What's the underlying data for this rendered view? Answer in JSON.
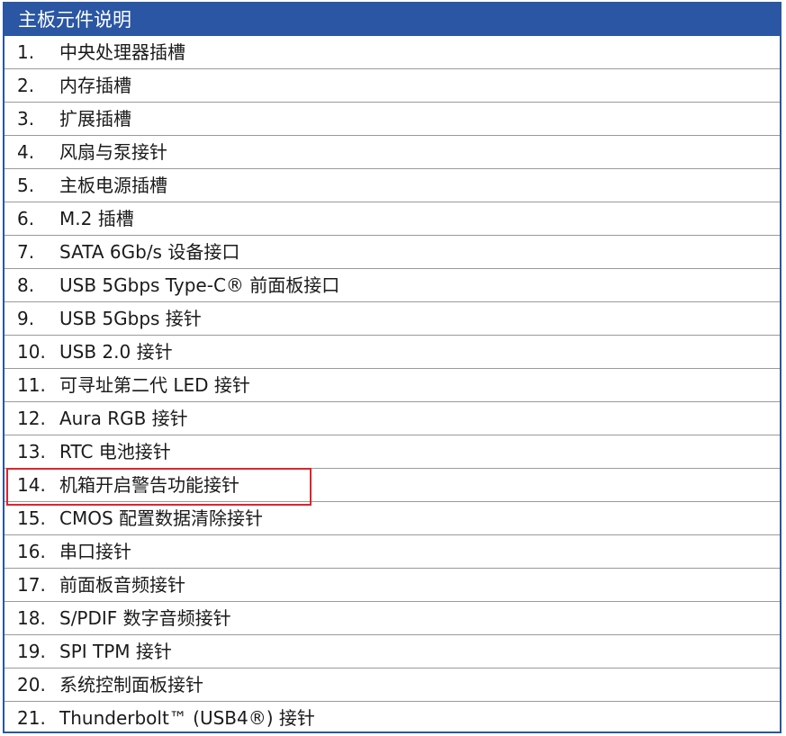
{
  "header": {
    "title": "主板元件说明"
  },
  "items": [
    {
      "num": "1.",
      "label": "中央处理器插槽"
    },
    {
      "num": "2.",
      "label": "内存插槽"
    },
    {
      "num": "3.",
      "label": "扩展插槽"
    },
    {
      "num": "4.",
      "label": "风扇与泵接针"
    },
    {
      "num": "5.",
      "label": "主板电源插槽"
    },
    {
      "num": "6.",
      "label": "M.2 插槽"
    },
    {
      "num": "7.",
      "label": "SATA 6Gb/s 设备接口"
    },
    {
      "num": "8.",
      "label": "USB 5Gbps Type-C® 前面板接口"
    },
    {
      "num": "9.",
      "label": "USB 5Gbps 接针"
    },
    {
      "num": "10.",
      "label": "USB 2.0 接针"
    },
    {
      "num": "11.",
      "label": "可寻址第二代 LED 接针"
    },
    {
      "num": "12.",
      "label": "Aura RGB 接针"
    },
    {
      "num": "13.",
      "label": "RTC 电池接针"
    },
    {
      "num": "14.",
      "label": "机箱开启警告功能接针"
    },
    {
      "num": "15.",
      "label": "CMOS 配置数据清除接针"
    },
    {
      "num": "16.",
      "label": "串口接针"
    },
    {
      "num": "17.",
      "label": "前面板音频接针"
    },
    {
      "num": "18.",
      "label": "S/PDIF 数字音频接针"
    },
    {
      "num": "19.",
      "label": "SPI TPM 接针"
    },
    {
      "num": "20.",
      "label": "系统控制面板接针"
    },
    {
      "num": "21.",
      "label": "Thunderbolt™ (USB4®) 接针"
    }
  ],
  "highlight_index": 13,
  "colors": {
    "header_bg": "#2a56a3",
    "highlight": "#e3222b"
  }
}
